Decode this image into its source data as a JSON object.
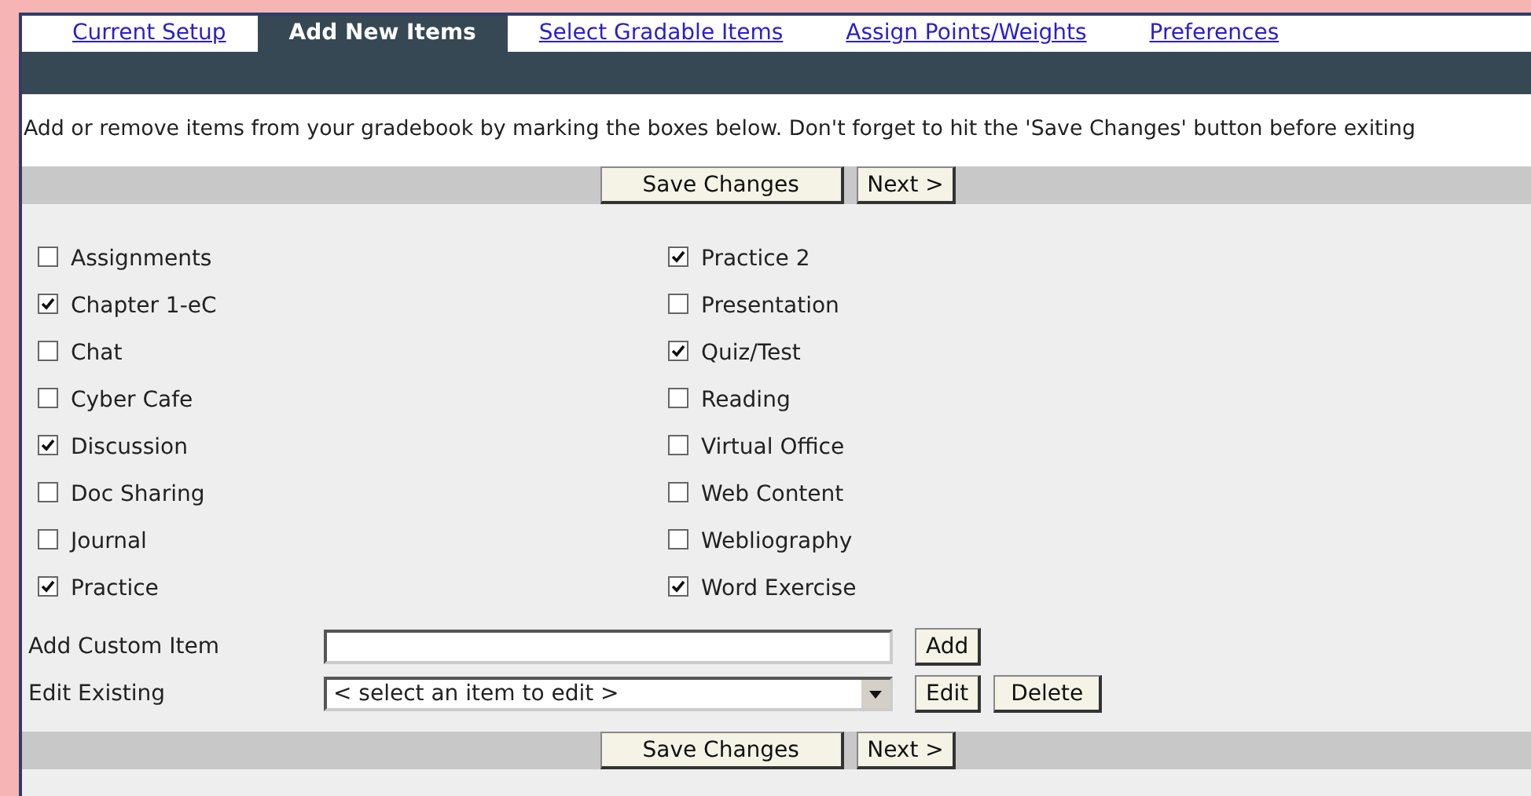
{
  "tabs": [
    {
      "label": "Current Setup",
      "selected": false
    },
    {
      "label": "Add New Items",
      "selected": true
    },
    {
      "label": "Select Gradable Items",
      "selected": false
    },
    {
      "label": "Assign Points/Weights",
      "selected": false
    },
    {
      "label": "Preferences",
      "selected": false
    }
  ],
  "instructions": "Add or remove items from your gradebook by marking the boxes below. Don't forget to hit the 'Save Changes' button before exiting",
  "top_buttons": [
    "Save Changes",
    "Next >"
  ],
  "columns": [
    [
      {
        "label": "Assignments",
        "checked": false
      },
      {
        "label": "Chapter 1-eC",
        "checked": true
      },
      {
        "label": "Chat",
        "checked": false
      },
      {
        "label": "Cyber Cafe",
        "checked": false
      },
      {
        "label": "Discussion",
        "checked": true
      },
      {
        "label": "Doc Sharing",
        "checked": false
      },
      {
        "label": "Journal",
        "checked": false
      },
      {
        "label": "Practice",
        "checked": true
      }
    ],
    [
      {
        "label": "Practice 2",
        "checked": true
      },
      {
        "label": "Presentation",
        "checked": false
      },
      {
        "label": "Quiz/Test",
        "checked": true
      },
      {
        "label": "Reading",
        "checked": false
      },
      {
        "label": "Virtual Office",
        "checked": false
      },
      {
        "label": "Web Content",
        "checked": false
      },
      {
        "label": "Webliography",
        "checked": false
      },
      {
        "label": "Word Exercise",
        "checked": true
      }
    ]
  ],
  "custom_item": {
    "label": "Add Custom Item",
    "button": "Add"
  },
  "edit_existing": {
    "label": "Edit Existing",
    "value": "< select an item to edit >",
    "buttons": [
      "Edit",
      "Delete"
    ]
  },
  "bottom_buttons": [
    "Save Changes",
    "Next >"
  ]
}
